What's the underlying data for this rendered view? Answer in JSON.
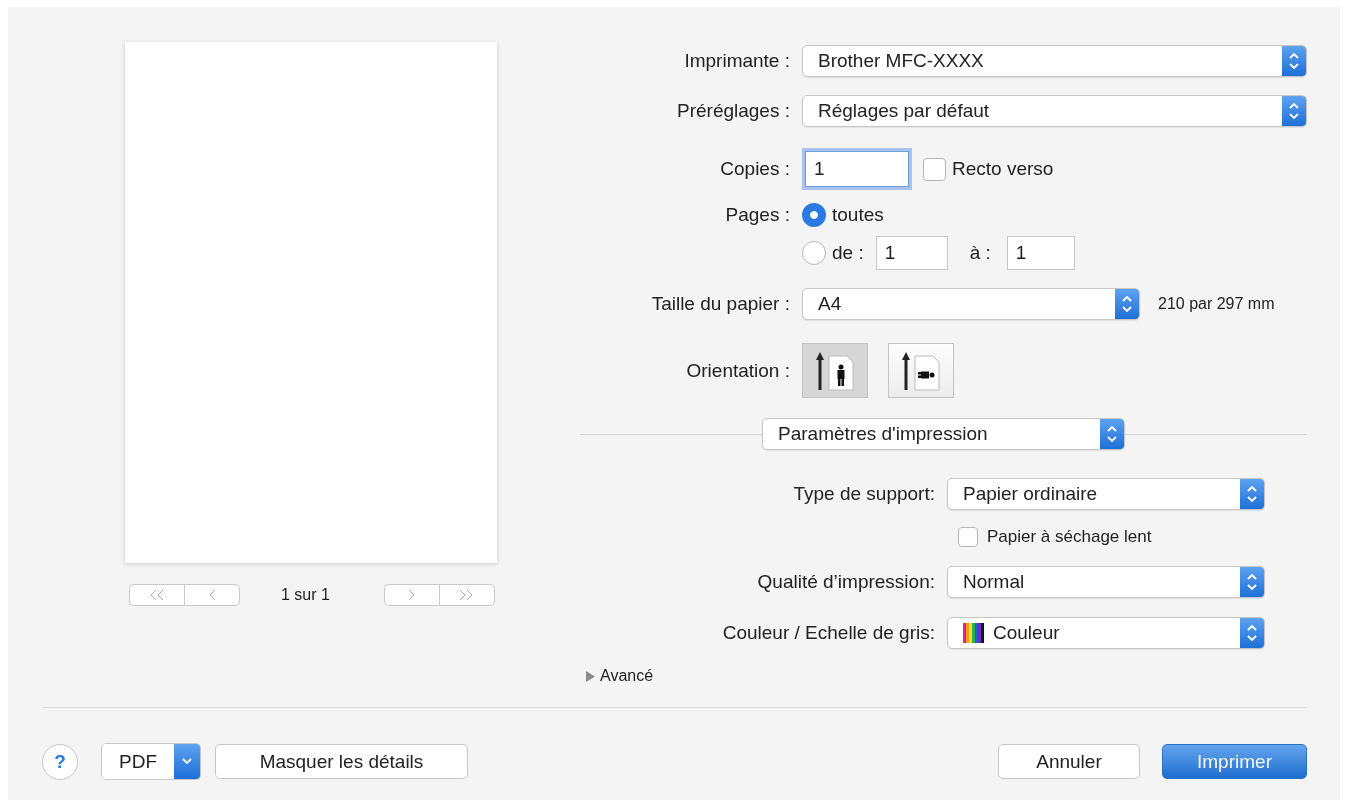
{
  "preview": {
    "page_counter": "1 sur 1"
  },
  "printer": {
    "label": "Imprimante :",
    "value": "Brother MFC-XXXX"
  },
  "presets": {
    "label": "Préréglages :",
    "value": "Réglages par défaut"
  },
  "copies": {
    "label": "Copies :",
    "value": "1",
    "duplex": {
      "label": "Recto verso",
      "checked": false
    }
  },
  "pages": {
    "label": "Pages :",
    "options": [
      {
        "kind": "all",
        "label": "toutes",
        "selected": true
      },
      {
        "kind": "range",
        "label": "de :",
        "selected": false,
        "from": "1",
        "to_label": "à :",
        "to": "1"
      }
    ]
  },
  "paper_size": {
    "label": "Taille du papier :",
    "value": "A4",
    "dimensions": "210 par 297 mm"
  },
  "orientation": {
    "label": "Orientation :",
    "options": [
      {
        "kind": "portrait",
        "selected": true
      },
      {
        "kind": "landscape",
        "selected": false
      }
    ]
  },
  "panel_menu": {
    "value": "Paramètres d'impression"
  },
  "settings": [
    {
      "kind": "popup",
      "label": "Type de support:",
      "value": "Papier ordinaire"
    },
    {
      "kind": "checkbox",
      "label": "Papier à séchage lent",
      "checked": false
    },
    {
      "kind": "popup",
      "label": "Qualité d’impression:",
      "value": "Normal"
    },
    {
      "kind": "color-popup",
      "label": "Couleur / Echelle de gris:",
      "value": "Couleur"
    }
  ],
  "advanced": {
    "label": "Avancé",
    "expanded": false
  },
  "footer": {
    "help": "?",
    "pdf": "PDF",
    "toggle_details": "Masquer les détails",
    "cancel": "Annuler",
    "print": "Imprimer"
  }
}
